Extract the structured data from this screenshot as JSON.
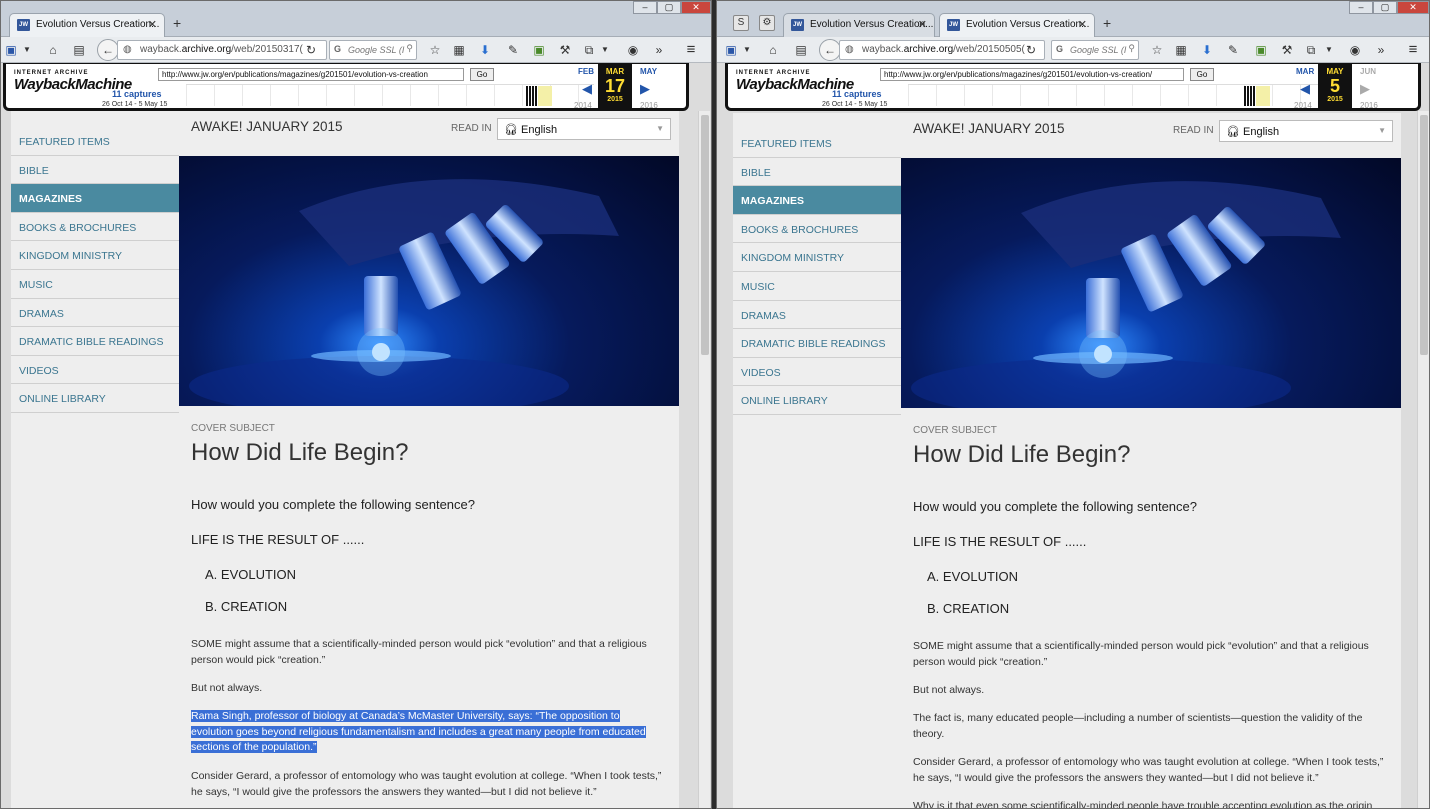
{
  "left": {
    "tabs": [
      {
        "label": "Evolution Versus Creation...",
        "favicon": "JW"
      }
    ],
    "address_prefix": "wayback.",
    "address_host": "archive.org",
    "address_rest": "/web/20150317(",
    "search_placeholder": "Google SSL (I",
    "wayback": {
      "url": "http://www.jw.org/en/publications/magazines/g201501/evolution-vs-creation",
      "go": "Go",
      "captures": "11 captures",
      "range": "26 Oct 14 - 5 May 15",
      "prev_month": "FEB",
      "cur_month": "MAR",
      "cur_day": "17",
      "cur_year": "2015",
      "next_month": "MAY",
      "prev_year": "2014",
      "next_year": "2016"
    },
    "page": {
      "issue_title": "AWAKE! JANUARY 2015",
      "read_in": "READ IN",
      "language": "English",
      "cover_subject": "COVER SUBJECT",
      "headline": "How Did Life Begin?",
      "question": "How would you complete the following sentence?",
      "life": "LIFE IS THE RESULT OF ......",
      "option_a": "A. EVOLUTION",
      "option_b": "B. CREATION",
      "p1": "SOME might assume that a scientifically-minded person would pick “evolution” and that a religious person would pick “creation.”",
      "p2": "But not always.",
      "p3": "Rama Singh, professor of biology at Canada’s McMaster University, says: “The opposition to evolution goes beyond religious fundamentalism and includes a great many people from educated sections of the population.”",
      "p4": "Consider Gerard, a professor of entomology who was taught evolution at college. “When I took tests,” he says, “I would give the professors the answers they wanted—but I did not believe it.”"
    }
  },
  "right": {
    "tabs": [
      {
        "label": "Evolution Versus Creation...",
        "favicon": "JW"
      },
      {
        "label": "Evolution Versus Creation...",
        "favicon": "JW"
      }
    ],
    "address_prefix": "wayback.",
    "address_host": "archive.org",
    "address_rest": "/web/20150505(",
    "search_placeholder": "Google SSL (I",
    "wayback": {
      "url": "http://www.jw.org/en/publications/magazines/g201501/evolution-vs-creation/",
      "go": "Go",
      "captures": "11 captures",
      "range": "26 Oct 14 - 5 May 15",
      "prev_month": "MAR",
      "cur_month": "MAY",
      "cur_day": "5",
      "cur_year": "2015",
      "next_month": "JUN",
      "prev_year": "2014",
      "next_year": "2016"
    },
    "page": {
      "issue_title": "AWAKE! JANUARY 2015",
      "read_in": "READ IN",
      "language": "English",
      "cover_subject": "COVER SUBJECT",
      "headline": "How Did Life Begin?",
      "question": "How would you complete the following sentence?",
      "life": "LIFE IS THE RESULT OF ......",
      "option_a": "A. EVOLUTION",
      "option_b": "B. CREATION",
      "p1": "SOME might assume that a scientifically-minded person would pick “evolution” and that a religious person would pick “creation.”",
      "p2": "But not always.",
      "p3": "The fact is, many educated people—including a number of scientists—question the validity of the theory.",
      "p4": "Consider Gerard, a professor of entomology who was taught evolution at college. “When I took tests,” he says, “I would give the professors the answers they wanted—but I did not believe it.”",
      "p5": "Why is it that even some scientifically-minded people have trouble accepting evolution as the origin"
    }
  },
  "sidebar_items": [
    "FEATURED ITEMS",
    "BIBLE",
    "MAGAZINES",
    "BOOKS & BROCHURES",
    "KINGDOM MINISTRY",
    "MUSIC",
    "DRAMAS",
    "DRAMATIC BIBLE READINGS",
    "VIDEOS",
    "ONLINE LIBRARY"
  ],
  "active_sidebar": "MAGAZINES",
  "colors": {
    "accent": "#4a8aa0",
    "link": "#3b7690",
    "selection": "#3a6fd6",
    "wayback_yellow": "#ffdd33"
  },
  "icons": [
    "save-icon",
    "home-icon",
    "reader-icon",
    "back-icon",
    "globe-icon",
    "reload-icon",
    "bookmark-star-icon",
    "bookmarks-list-icon",
    "download-icon",
    "addon-icon",
    "sync-icon",
    "account-icon",
    "overflow-icon",
    "menu-icon"
  ]
}
